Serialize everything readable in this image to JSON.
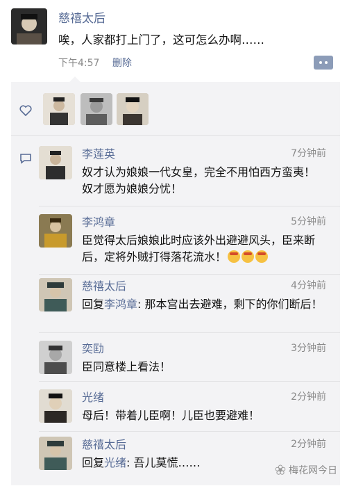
{
  "post": {
    "author": "慈禧太后",
    "text": "唉，人家都打上门了，这可怎么办啊……",
    "time": "下午4:57",
    "delete_label": "删除"
  },
  "likes": {
    "avatars": [
      "like-avatar-1",
      "like-avatar-2",
      "like-avatar-3"
    ]
  },
  "comments": [
    {
      "name": "李莲英",
      "time": "7分钟前",
      "text": "奴才认为娘娘一代女皇，完全不用怕西方蛮夷！奴才愿为娘娘分忧！"
    },
    {
      "name": "李鸿章",
      "time": "5分钟前",
      "text": "臣觉得太后娘娘此时应该外出避避风头，臣来断后，定将外贼打得落花流水！",
      "emojis": [
        "emoji-1",
        "emoji-2",
        "emoji-3"
      ]
    },
    {
      "name": "慈禧太后",
      "time": "4分钟前",
      "reply_prefix": "回复",
      "reply_to": "李鸿章",
      "text": ": 那本宫出去避难，剩下的你们断后！"
    },
    {
      "name": "奕劻",
      "time": "3分钟前",
      "text": "臣同意楼上看法！"
    },
    {
      "name": "光绪",
      "time": "2分钟前",
      "text": "母后！带着儿臣啊！儿臣也要避难！"
    },
    {
      "name": "慈禧太后",
      "time": "2分钟前",
      "reply_prefix": "回复",
      "reply_to": "光绪",
      "text": ": 吾儿莫慌……"
    }
  ],
  "watermark": "梅花网今日",
  "colors": {
    "link": "#576b95",
    "panel": "#f3f3f5",
    "meta": "#8a8a8a"
  }
}
